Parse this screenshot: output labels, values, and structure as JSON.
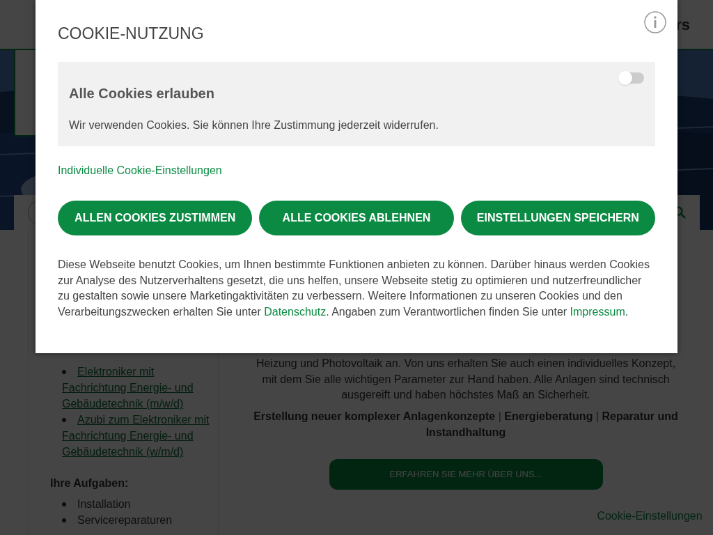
{
  "page": {
    "header_logo_fragment": "rs",
    "hero": {
      "kind": "picture"
    },
    "jobs": [
      "Elektroniker mit Fachrichtung Energie- und Gebäudetechnik (m/w/d)",
      "Azubi zum Elektroniker mit Fachrichtung Energie- und Gebäudetechnik (w/m/d)"
    ],
    "tasks_heading": "Ihre Aufgaben:",
    "tasks": [
      "Installation",
      "Servicereparaturen"
    ],
    "intro": "Heizung und Photovoltaik an. Von uns erhalten Sie auch einen individuelles Konzept, mit dem Sie alle wichtigen Parameter zur Hand haben. Alle Anlagen sind technisch ausgereift und haben höchstes Maß an Sicherheit.",
    "services": [
      "Erstellung neuer komplexer Anlagenkonzepte",
      "Energieberatung",
      "Reparatur und Instandhaltung"
    ],
    "services_separator": "|",
    "more_button": "ERFAHREN SIE MEHR ÜBER UNS...",
    "cookie_settings_tab": "Cookie-Einstellungen"
  },
  "cookie_dialog": {
    "title": "COOKIE-NUTZUNG",
    "allow_all": {
      "label": "Alle Cookies erlauben",
      "on": false,
      "description": "Wir verwenden Cookies. Sie können Ihre Zustimmung jederzeit widerrufen."
    },
    "individual_link": "Individuelle Cookie-Einstellungen",
    "buttons": [
      "ALLEN COOKIES ZUSTIMMEN",
      "ALLE COOKIES ABLEHNEN",
      "EINSTELLUNGEN SPEICHERN"
    ],
    "notice": [
      {
        "kind": "text",
        "text": "Diese Webseite benutzt Cookies, um Ihnen bestimmte Funktionen anbieten zu können. Darüber hinaus werden Cookies zur Analyse des Nutzerverhaltens gesetzt, die uns helfen, unsere Webseite stetig zu optimieren und nutzerfreundlicher zu gestalten sowie unsere Marketingaktivitäten zu verbessern. Weitere Informationen zu unseren Cookies und den Verarbeitungszwecken erhalten Sie unter "
      },
      {
        "kind": "link",
        "text": "Datenschutz"
      },
      {
        "kind": "text",
        "text": ". Angaben zum Verantwortlichen finden Sie unter "
      },
      {
        "kind": "link",
        "text": "Impressum"
      },
      {
        "kind": "text",
        "text": "."
      }
    ]
  }
}
